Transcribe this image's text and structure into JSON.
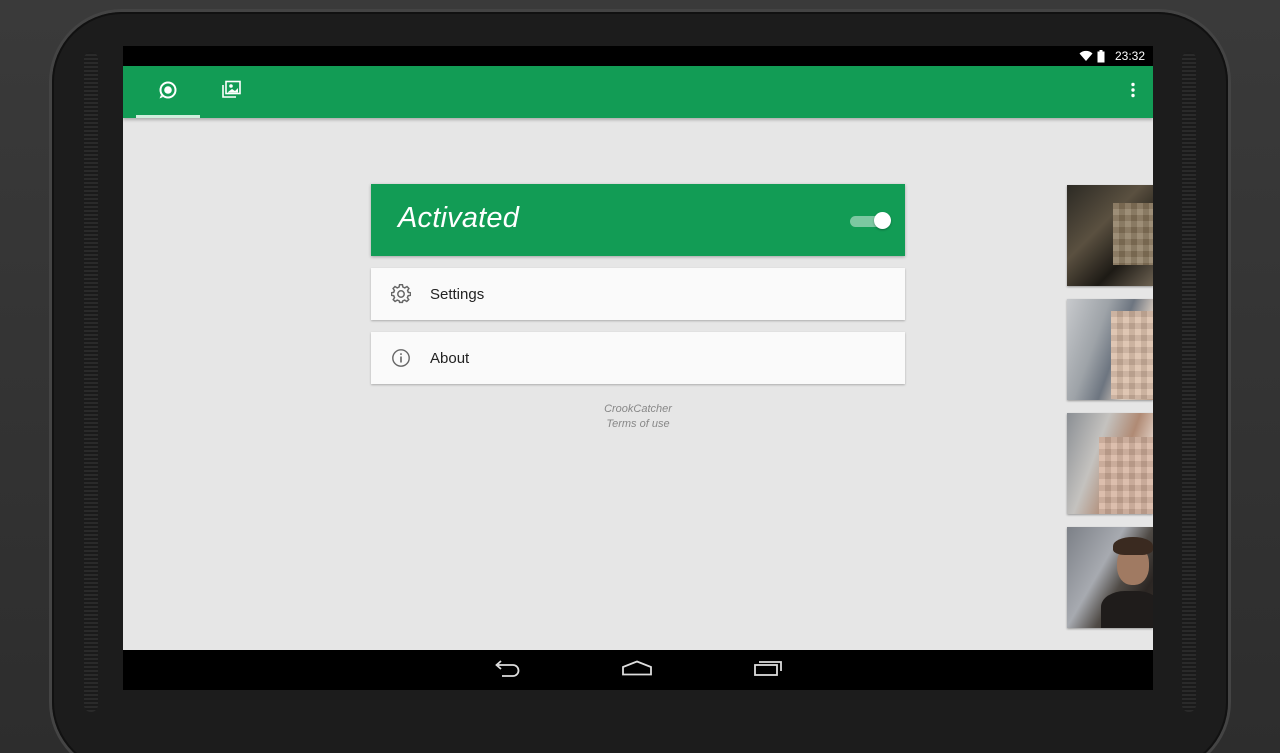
{
  "status_bar": {
    "time": "23:32",
    "icons": [
      "wifi-icon",
      "battery-icon"
    ]
  },
  "action_bar": {
    "tabs": [
      {
        "icon": "detector-icon",
        "selected": true
      },
      {
        "icon": "gallery-icon",
        "selected": false
      }
    ],
    "overflow_icon": "overflow-menu-icon"
  },
  "activation": {
    "label": "Activated",
    "toggle_on": true
  },
  "menu": {
    "items": [
      {
        "label": "Settings",
        "icon": "gear-icon"
      },
      {
        "label": "About",
        "icon": "info-icon"
      }
    ]
  },
  "footer": {
    "app_name": "CrookCatcher",
    "terms": "Terms of use"
  },
  "thumbnails": {
    "count_visible": 4
  },
  "colors": {
    "primary_green": "#129c55",
    "background": "#e6e6e6",
    "card": "#fafafa"
  },
  "nav_bar": {
    "icons": [
      "back-icon",
      "home-icon",
      "recents-icon"
    ]
  }
}
